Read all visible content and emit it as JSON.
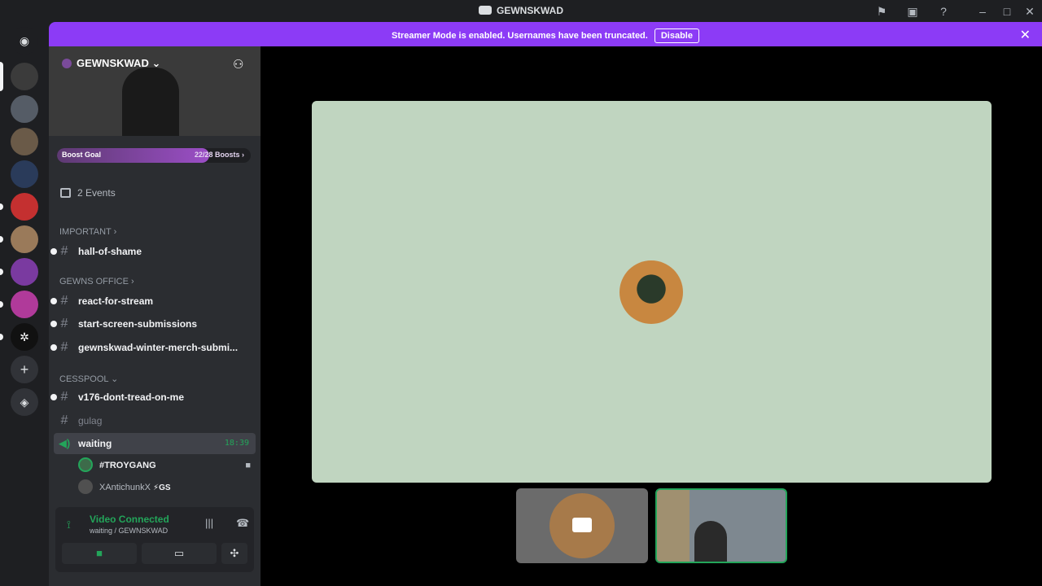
{
  "app": {
    "title": "GEWNSKWAD"
  },
  "titlebar_icons": [
    "flag-icon",
    "inbox-icon",
    "help-icon",
    "minimize-icon",
    "maximize-icon",
    "close-icon"
  ],
  "banner": {
    "message": "Streamer Mode is enabled. Usernames have been truncated.",
    "button": "Disable"
  },
  "server": {
    "name": "GEWNSKWAD",
    "boost_label": "Boost Goal",
    "boost_count": "22/28 Boosts",
    "boost_progress": 0.786,
    "events": "2 Events"
  },
  "categories": {
    "important": "IMPORTANT",
    "gewns_office": "GEWNS OFFICE",
    "cesspool": "CESSPOOL"
  },
  "channels": {
    "hall_of_shame": "hall-of-shame",
    "react_for_stream": "react-for-stream",
    "start_screen": "start-screen-submissions",
    "winter_merch": "gewnskwad-winter-merch-submi...",
    "v176": "v176-dont-tread-on-me",
    "gulag": "gulag",
    "voice_waiting": "waiting",
    "voice_timer": "18:39"
  },
  "voice_users": [
    "#TROYGANG",
    "XAntichunkX"
  ],
  "voice_user_tag": "⚡GS",
  "voice_panel": {
    "status": "Video Connected",
    "location": "waiting / GEWNSKWAD"
  },
  "colors": {
    "accent": "#8c3bf6",
    "green": "#23a55a",
    "stage_bg": "#c0d5c0"
  }
}
